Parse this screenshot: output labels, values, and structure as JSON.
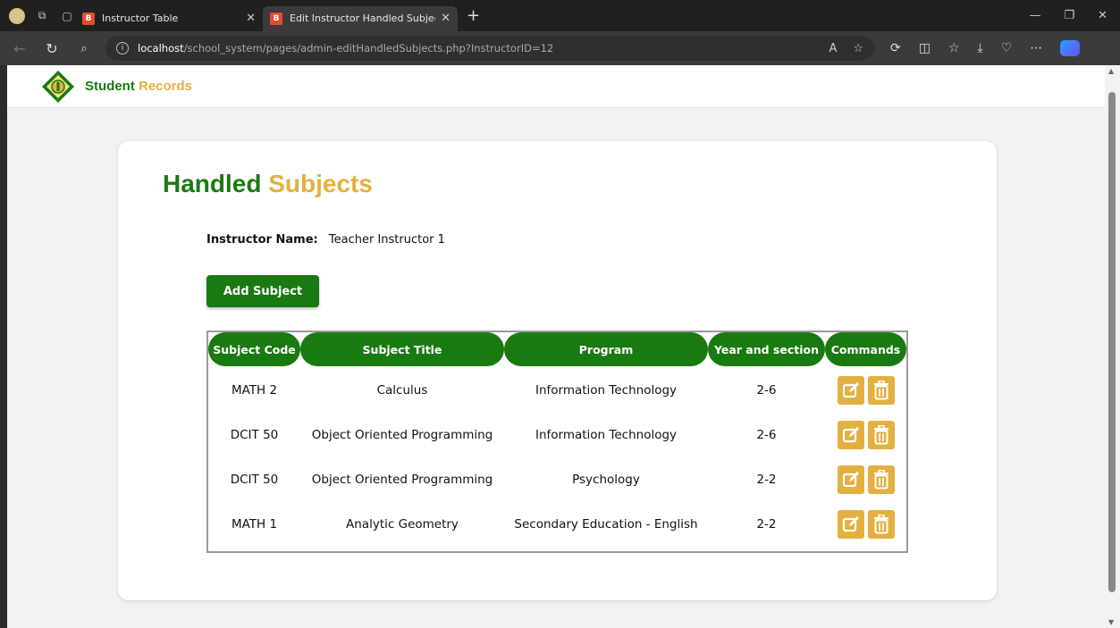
{
  "browser": {
    "tabs": [
      {
        "title": "Instructor Table",
        "active": false,
        "favicon_text": "B"
      },
      {
        "title": "Edit Instructor Handled Subjects",
        "active": true,
        "favicon_text": "B"
      }
    ],
    "url_host": "localhost",
    "url_path": "/school_system/pages/admin-editHandledSubjects.php?InstructorID=12"
  },
  "header": {
    "brand_part1": "Student",
    "brand_part2": "Records"
  },
  "page": {
    "title_part1": "Handled",
    "title_part2": "Subjects",
    "instructor_label": "Instructor Name:",
    "instructor_name": "Teacher Instructor 1",
    "add_button": "Add Subject"
  },
  "table": {
    "headers": [
      "Subject Code",
      "Subject Title",
      "Program",
      "Year and section",
      "Commands"
    ],
    "rows": [
      {
        "code": "MATH 2",
        "title": "Calculus",
        "program": "Information Technology",
        "year_section": "2-6"
      },
      {
        "code": "DCIT 50",
        "title": "Object Oriented Programming",
        "program": "Information Technology",
        "year_section": "2-6"
      },
      {
        "code": "DCIT 50",
        "title": "Object Oriented Programming",
        "program": "Psychology",
        "year_section": "2-2"
      },
      {
        "code": "MATH 1",
        "title": "Analytic Geometry",
        "program": "Secondary Education - English",
        "year_section": "2-2"
      }
    ]
  },
  "colors": {
    "brand_green": "#1a7a12",
    "brand_gold": "#e3b040"
  }
}
